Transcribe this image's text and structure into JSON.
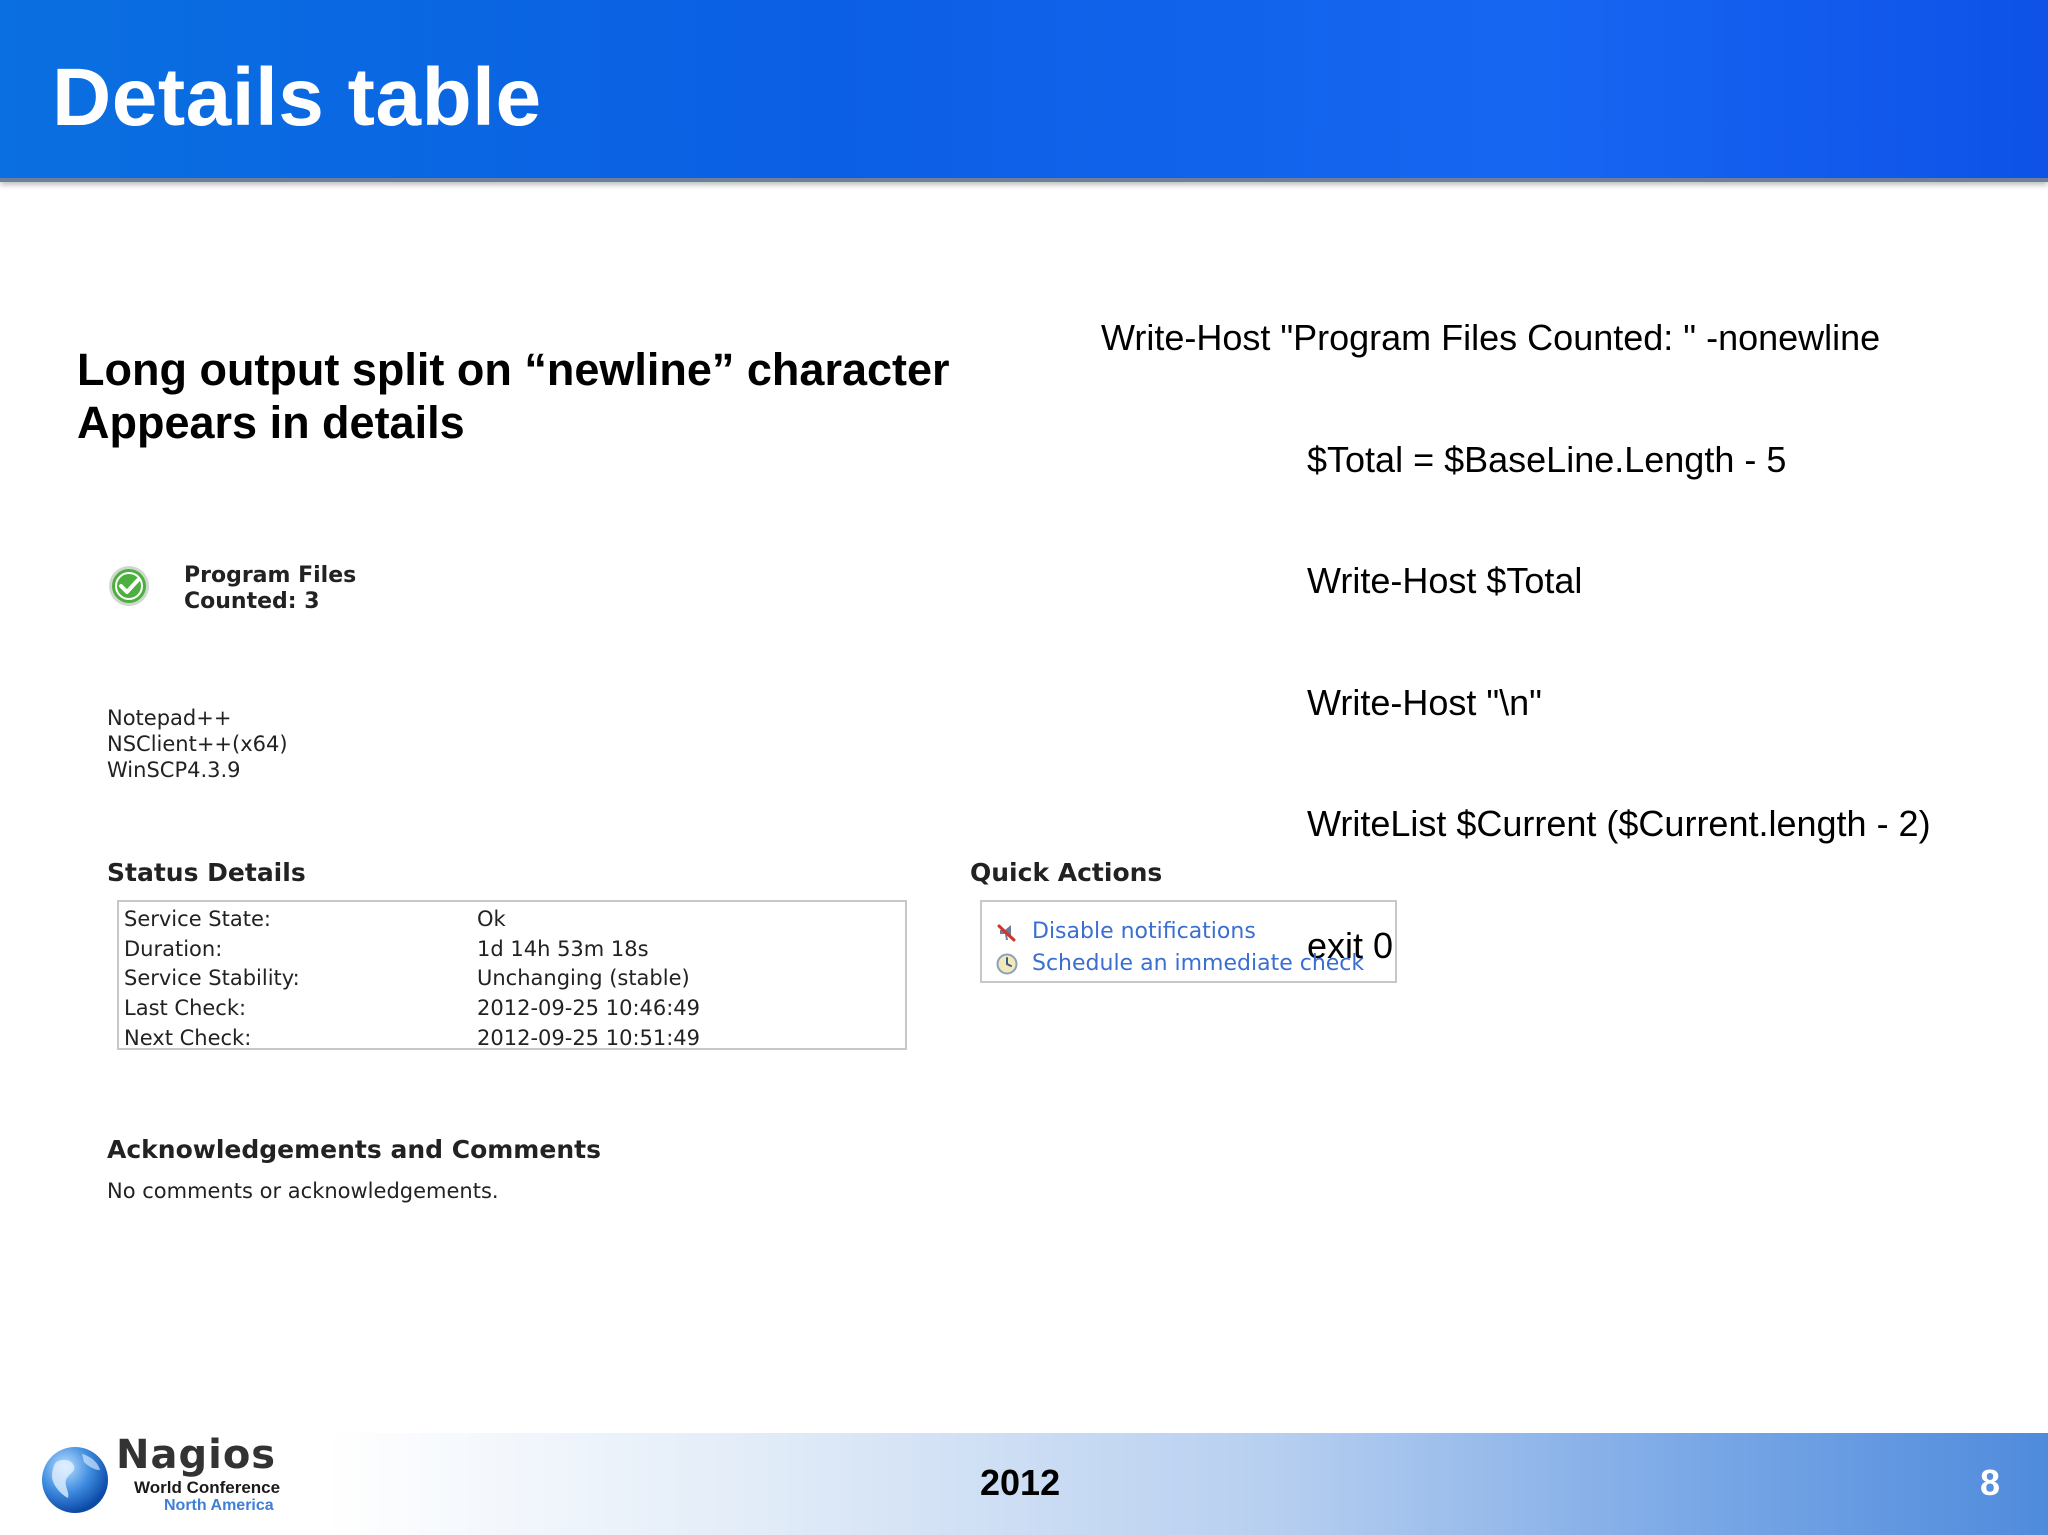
{
  "slide": {
    "title": "Details table",
    "subhead": {
      "line1": "Long output split on “newline” character",
      "line2": "Appears in details"
    },
    "code": {
      "lines": [
        "Write-Host \"Program Files Counted: \" -nonewline",
        "$Total = $BaseLine.Length - 5",
        "Write-Host $Total",
        "Write-Host \"\\n\"",
        "WriteList $Current ($Current.length - 2)",
        "exit 0"
      ]
    }
  },
  "nagios": {
    "status_summary": {
      "line1": "Program Files",
      "line2": "Counted: 3",
      "icon": "check-circle-icon",
      "icon_color": "#4caf3f"
    },
    "files": [
      "Notepad++",
      "NSClient++(x64)",
      "WinSCP4.3.9"
    ],
    "status_details": {
      "title": "Status Details",
      "rows": [
        {
          "key": "Service State:",
          "value": "Ok"
        },
        {
          "key": "Duration:",
          "value": "1d 14h 53m 18s"
        },
        {
          "key": "Service Stability:",
          "value": "Unchanging (stable)"
        },
        {
          "key": "Last Check:",
          "value": "2012-09-25 10:46:49"
        },
        {
          "key": "Next Check:",
          "value": "2012-09-25 10:51:49"
        }
      ]
    },
    "quick_actions": {
      "title": "Quick Actions",
      "items": [
        {
          "label": "Disable notifications",
          "icon": "megaphone-muted-icon"
        },
        {
          "label": "Schedule an immediate check",
          "icon": "clock-icon"
        }
      ],
      "link_color": "#3a6fd0"
    },
    "acknowledgements": {
      "title": "Acknowledgements and Comments",
      "text": "No comments or acknowledgements."
    }
  },
  "footer": {
    "logo_brand": "Nagios",
    "logo_line1": "World Conference",
    "logo_line2": "North America",
    "year": "2012",
    "page_number": "8"
  },
  "colors": {
    "header_blue": "#0b5fe4",
    "link_blue": "#3a6fd0"
  }
}
